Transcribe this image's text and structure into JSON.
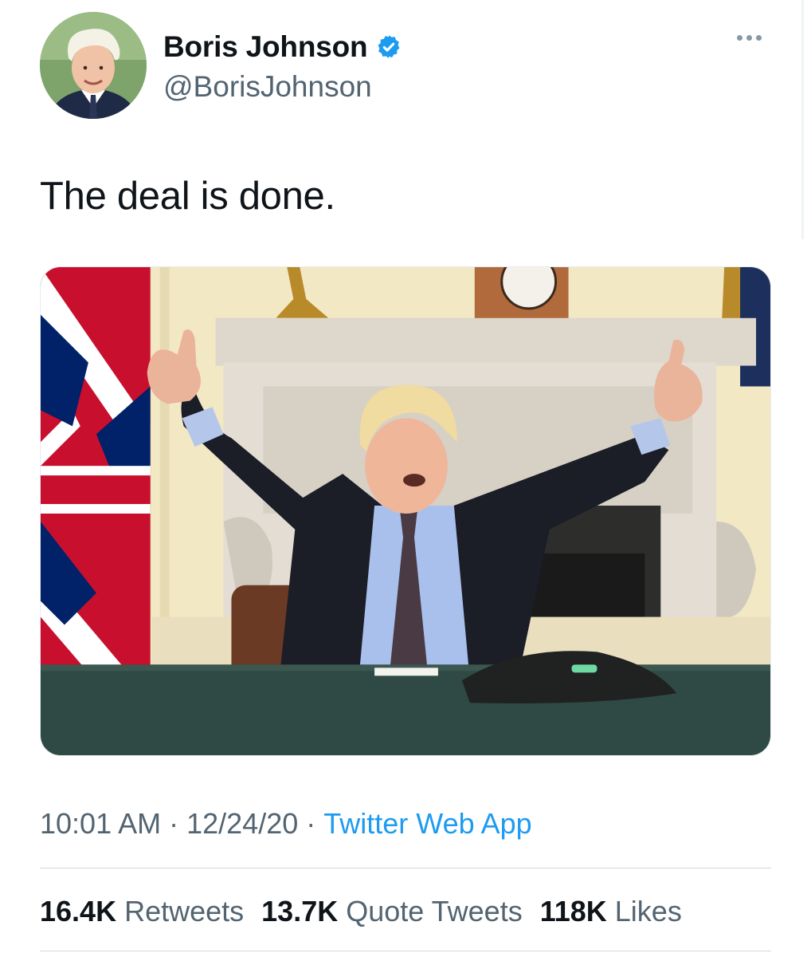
{
  "author": {
    "display_name": "Boris Johnson",
    "handle": "@BorisJohnson",
    "verified": true,
    "avatar_icon": "profile-photo"
  },
  "more_icon": "ellipsis-icon",
  "tweet": {
    "text": "The deal is done."
  },
  "meta": {
    "time": "10:01 AM",
    "separator": "·",
    "date": "12/24/20",
    "source": "Twitter Web App"
  },
  "stats": {
    "retweets_count": "16.4K",
    "retweets_label": "Retweets",
    "quotes_count": "13.7K",
    "quotes_label": "Quote Tweets",
    "likes_count": "118K",
    "likes_label": "Likes"
  },
  "colors": {
    "link": "#1d9bf0",
    "verified": "#1d9bf0",
    "secondary_text": "#536471",
    "primary_text": "#0f1419"
  }
}
